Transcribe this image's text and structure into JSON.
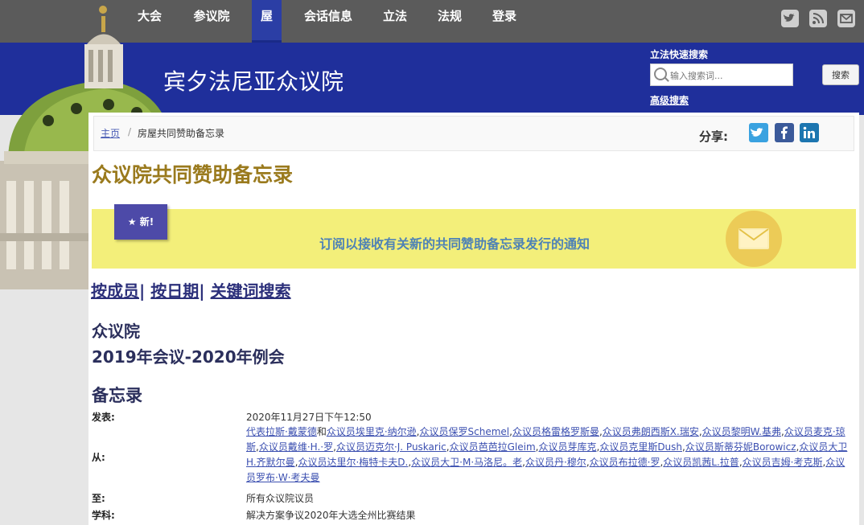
{
  "nav": {
    "items": [
      {
        "label": "大会",
        "key": "assembly"
      },
      {
        "label": "参议院",
        "key": "senate"
      },
      {
        "label": "屋",
        "key": "house"
      },
      {
        "label": "会话信息",
        "key": "session-info"
      },
      {
        "label": "立法",
        "key": "legislation"
      },
      {
        "label": "法规",
        "key": "statutes"
      },
      {
        "label": "登录",
        "key": "login"
      }
    ],
    "social": [
      "twitter-icon",
      "rss-icon",
      "email-icon"
    ]
  },
  "header": {
    "site_title": "宾夕法尼亚众议院",
    "quick_search_label": "立法快速搜索",
    "search_placeholder": "输入搜索词...",
    "search_button": "搜索",
    "advanced_search": "高级搜索"
  },
  "breadcrumb": {
    "home": "主页",
    "separator": "/",
    "current": "房屋共同赞助备忘录"
  },
  "share": {
    "label": "分享:",
    "icons": [
      "twitter-icon",
      "facebook-icon",
      "linkedin-icon"
    ]
  },
  "page_title": "众议院共同赞助备忘录",
  "banner": {
    "badge": "★ 新!",
    "text": "订阅以接收有关新的共同赞助备忘录发行的通知"
  },
  "links": {
    "by_member": "按成员",
    "by_date": "按日期",
    "by_keyword": "关键词搜索"
  },
  "chamber": "众议院",
  "session": "2019年会议-2020年例会",
  "memo_heading": "备忘录",
  "memo": {
    "posted_label": "发表:",
    "posted_value": "2020年11月27日下午12:50",
    "from_label": "从:",
    "from_first": "代表拉斯·戴蒙德",
    "from_and": "和",
    "from_members": [
      "众议员埃里克·纳尔逊",
      "众议员保罗Schemel",
      "众议员格雷格罗斯曼",
      "众议员弗朗西斯X.瑞安",
      "众议员黎明W.基弗",
      "众议员麦克·琼斯",
      "众议员戴维·H.·罗",
      "众议员迈克尔·J. Puskaric",
      "众议员芭芭拉Gleim",
      "众议员芽库克",
      "众议员克里斯Dush",
      "众议员斯蒂芬妮Borowicz",
      "众议员大卫H.齐默尔曼",
      "众议员达里尔·梅特卡夫D.",
      "众议员大卫·M·马洛尼。老",
      "众议员丹·穆尔",
      "众议员布拉德·罗",
      "众议员凯茜L.拉普",
      "众议员吉姆·考克斯",
      "众议员罗布·W·考夫曼"
    ],
    "to_label": "至:",
    "to_value": "所有众议院议员",
    "subject_label": "学科:",
    "subject_value": "解决方案争议2020年大选全州比赛结果"
  },
  "colors": {
    "nav_bg": "#5b5b5b",
    "header_bg": "#1f2f9b",
    "title_gold": "#9a7a1d",
    "banner_yellow": "#f3ef7a",
    "link_blue": "#3b4fb0"
  }
}
